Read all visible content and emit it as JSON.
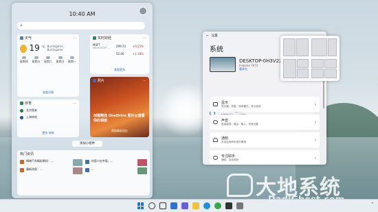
{
  "widgets": {
    "time": "10:40 AM",
    "search_placeholder": "",
    "weather": {
      "header": "天气",
      "temp": "19",
      "unit": "°C",
      "location": "Burlingame, Burlingame",
      "days": [
        "星期四",
        "星期五",
        "星期六",
        "星期日",
        "星期一"
      ],
      "link": "查看详情"
    },
    "stocks": {
      "header": "实时财经",
      "rows": [
        {
          "symbol": "MSFT",
          "name": "MICROSOFT ...",
          "price": "299.72",
          "change": "+0.25%"
        },
        {
          "symbol": "",
          "name": "",
          "price": "52.00",
          "change": "+1.38%"
        }
      ],
      "link": "查看更多"
    },
    "photo": {
      "header": "照片",
      "caption": "创建精选 OneDrive 照片以查看你的相册",
      "link": "获取精彩回忆"
    },
    "sports": {
      "header": "体育",
      "team1": "北京国安",
      "team2": "上海申花",
      "link": "更多 体育"
    },
    "add_button": "添加小组件",
    "news": {
      "header": "热门资讯",
      "items": [
        "揭晓汽车精彩瞬间：...",
        "外国人在中国，...",
        "最新消息：...",
        "..."
      ]
    }
  },
  "settings": {
    "window_title": "设置",
    "title": "系统",
    "pc_name": "DESKTOP-0H3V22M",
    "pc_model": "Inspiron 7472",
    "pc_rename": "重命名",
    "update_title": "Windows 更新",
    "update_status": "上次检查时间: 6 小时前",
    "rows": [
      {
        "title": "显示",
        "sub": "显示器、亮度、夜间模式、显示描述"
      },
      {
        "title": "声音",
        "sub": "音量级别、输出、输入、声音设备"
      },
      {
        "title": "通知",
        "sub": "来自应用和系统的警报"
      },
      {
        "title": "专注助手",
        "sub": "通知、自动规则"
      }
    ]
  },
  "watermark": {
    "text": "大地系统",
    "sub": "DadiGhost.com"
  },
  "taskbar": {
    "tray_text": "^"
  },
  "colors": {
    "accent": "#1a78d6",
    "stock_up": "#c0392b"
  }
}
